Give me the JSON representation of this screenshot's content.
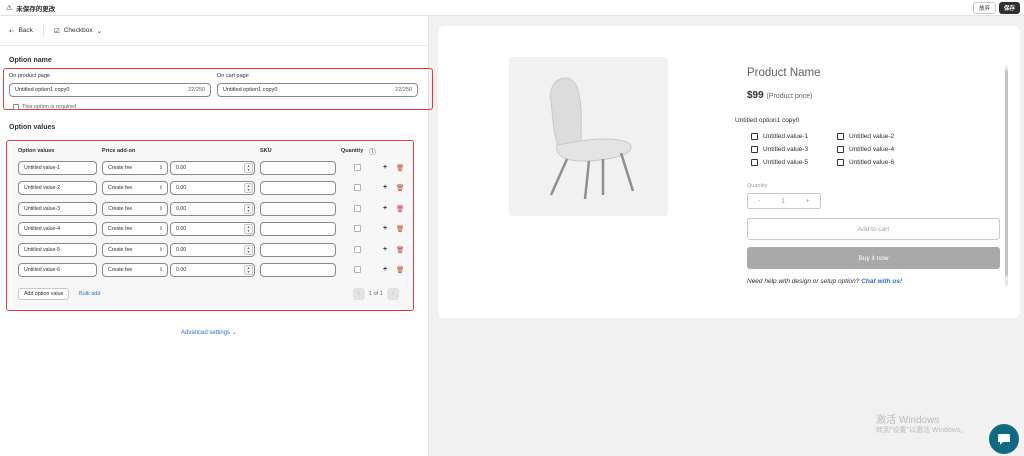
{
  "topbar": {
    "warning_icon": "warning-icon",
    "title": "未保存的更改",
    "discard_label": "放弃",
    "save_label": "保存"
  },
  "subbar": {
    "back_label": "Back",
    "type_label": "Checkbox"
  },
  "option_name": {
    "heading": "Option name",
    "product_page_label": "On product page",
    "product_page_value": "Untitled option1 copy0",
    "product_page_count": "22/250",
    "cart_page_label": "On cart page",
    "cart_page_value": "Untitled option1 copy0",
    "cart_page_count": "22/250",
    "required_note": "This option is required"
  },
  "option_values": {
    "heading": "Option values",
    "columns": {
      "values": "Option values",
      "price": "Price add-on",
      "sku": "SKU",
      "quantity": "Quantity"
    },
    "rows": [
      {
        "value": "Untitled value-1",
        "price_type": "Create fee",
        "price": "0.00",
        "sku": ""
      },
      {
        "value": "Untitled value-2",
        "price_type": "Create fee",
        "price": "0.00",
        "sku": ""
      },
      {
        "value": "Untitled value-3",
        "price_type": "Create fee",
        "price": "0.00",
        "sku": ""
      },
      {
        "value": "Untitled value-4",
        "price_type": "Create fee",
        "price": "0.00",
        "sku": ""
      },
      {
        "value": "Untitled value-5",
        "price_type": "Create fee",
        "price": "0.00",
        "sku": ""
      },
      {
        "value": "Untitled value-6",
        "price_type": "Create fee",
        "price": "0.00",
        "sku": ""
      }
    ],
    "add_label": "Add option value",
    "bulk_label": "Bulk add",
    "pager": "1 of 1"
  },
  "advanced_label": "Advanced settings",
  "preview": {
    "product_name": "Product Name",
    "price": "$99",
    "price_note": "(Product price)",
    "option_title": "Untitled option1 copy0",
    "choices": [
      "Untitled value-1",
      "Untitled value-2",
      "Untitled value-3",
      "Untitled value-4",
      "Untitled value-5",
      "Untitled value-6"
    ],
    "quantity_label": "Quantity",
    "quantity_value": "1",
    "add_to_cart": "Add to cart",
    "buy_now": "Buy it now",
    "help_text": "Need help with design or setup option?",
    "chat_link": "Chat with us!"
  },
  "watermark": {
    "line1": "激活 Windows",
    "line2": "转到\"设置\"以激活 Windows。"
  },
  "colors": {
    "accent_link": "#2c6ecb",
    "highlight": "#e53935",
    "save_button": "#303030",
    "chat_fab": "#106b82"
  }
}
